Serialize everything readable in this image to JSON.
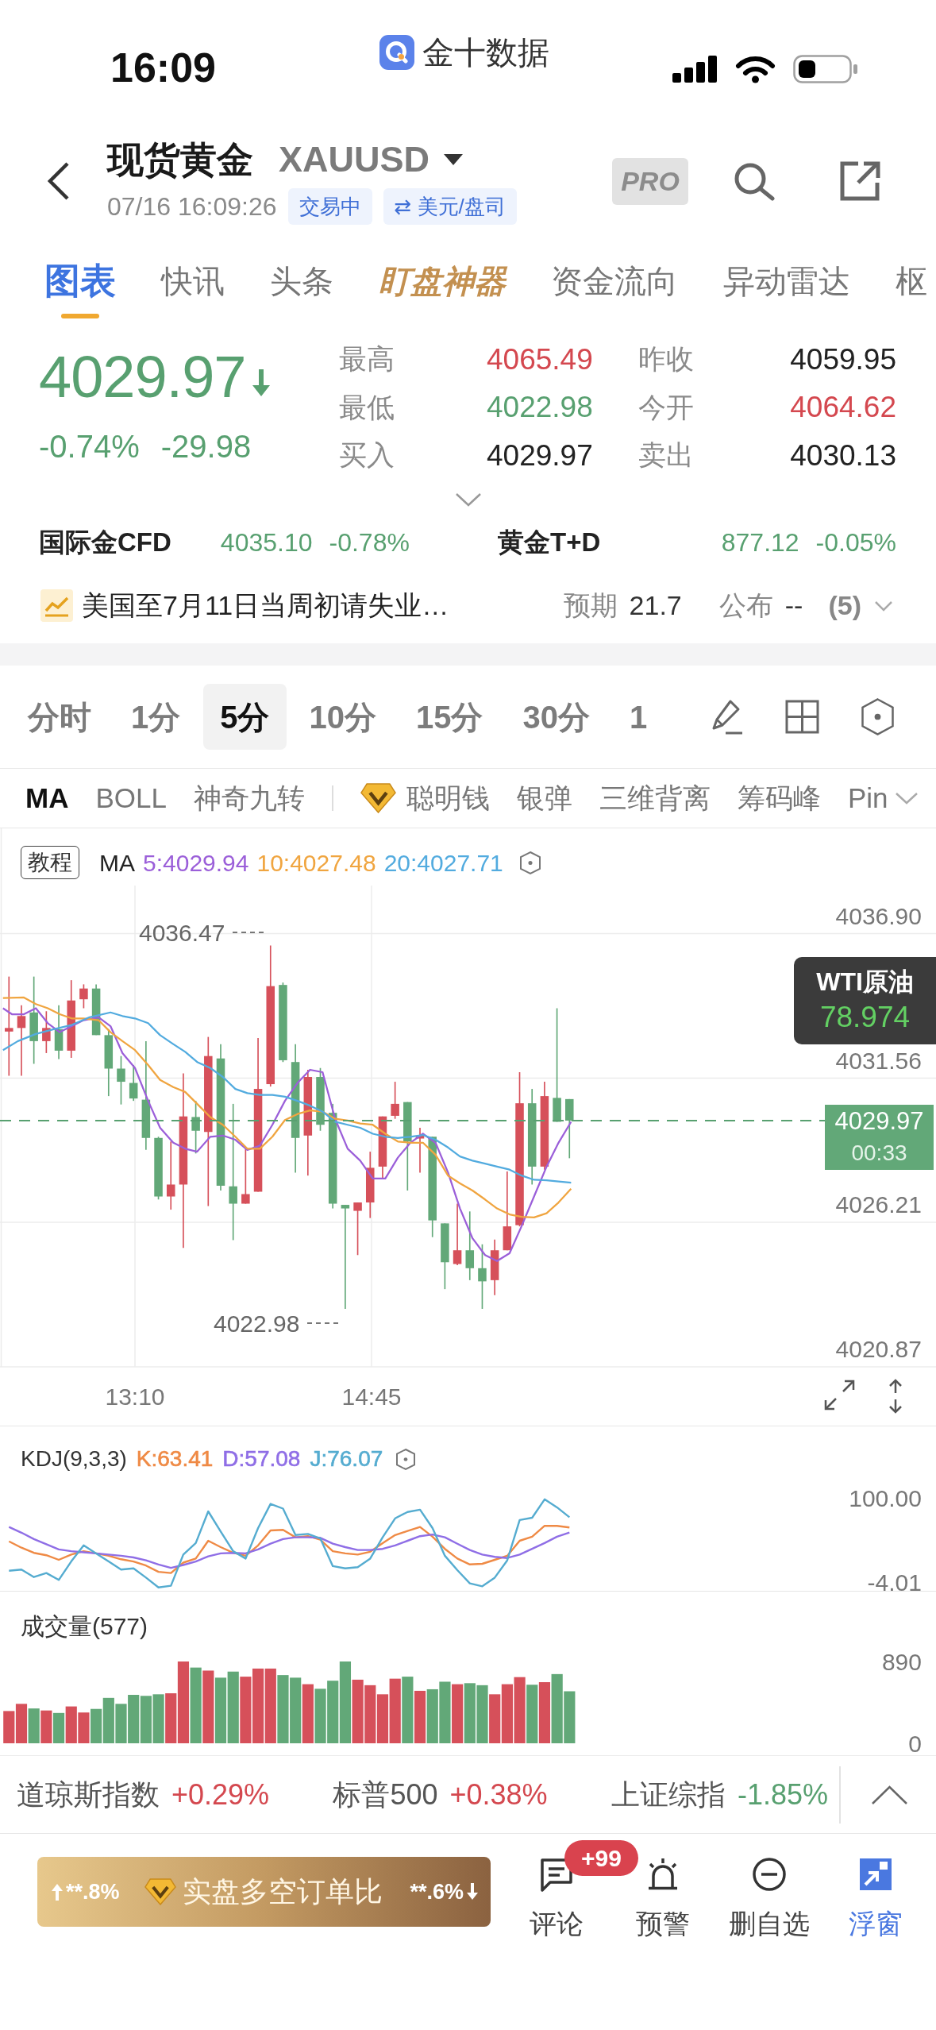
{
  "status_bar": {
    "time": "16:09",
    "app_name": "金十数据"
  },
  "header": {
    "title": "现货黄金",
    "symbol": "XAUUSD",
    "timestamp": "07/16 16:09:26",
    "badges": [
      "交易中",
      "⇄ 美元/盘司"
    ],
    "pro": "PRO"
  },
  "tabs": [
    {
      "label": "图表",
      "kind": "text",
      "selected": true
    },
    {
      "label": "快讯",
      "kind": "text",
      "selected": false
    },
    {
      "label": "头条",
      "kind": "text",
      "selected": false
    },
    {
      "label": "盯盘神器",
      "kind": "promo",
      "selected": false
    },
    {
      "label": "资金流向",
      "kind": "text",
      "selected": false
    },
    {
      "label": "异动雷达",
      "kind": "text",
      "selected": false
    },
    {
      "label": "枢",
      "kind": "text",
      "selected": false
    }
  ],
  "quote": {
    "price": "4029.97",
    "rising": false,
    "change_percent": "-0.74%",
    "change": "-29.98",
    "stats": [
      {
        "label": "最高",
        "value": "4065.49",
        "color": "#d4484f"
      },
      {
        "label": "昨收",
        "value": "4059.95",
        "color": "#222222"
      },
      {
        "label": "最低",
        "value": "4022.98",
        "color": "#58a070"
      },
      {
        "label": "今开",
        "value": "4064.62",
        "color": "#d4484f"
      },
      {
        "label": "买入",
        "value": "4029.97",
        "color": "#222222"
      },
      {
        "label": "卖出",
        "value": "4030.13",
        "color": "#222222"
      }
    ]
  },
  "related": [
    {
      "name": "国际金CFD",
      "price": "4035.10",
      "change": "-0.78%",
      "color": "#58a070"
    },
    {
      "name": "黄金T+D",
      "price": "877.12",
      "change": "-0.05%",
      "color": "#58a070"
    }
  ],
  "event": {
    "title": "美国至7月11日当周初请失业…",
    "expected_label": "预期",
    "expected": "21.7",
    "actual_label": "公布",
    "actual": "--",
    "count": "(5)"
  },
  "periods": [
    {
      "label": "分时",
      "selected": false
    },
    {
      "label": "1分",
      "selected": false
    },
    {
      "label": "5分",
      "selected": true
    },
    {
      "label": "10分",
      "selected": false
    },
    {
      "label": "15分",
      "selected": false
    },
    {
      "label": "30分",
      "selected": false
    },
    {
      "label": "1",
      "selected": false
    }
  ],
  "indicators": [
    {
      "label": "MA",
      "kind": "basic",
      "selected": true
    },
    {
      "label": "BOLL",
      "kind": "basic",
      "selected": false
    },
    {
      "label": "神奇九转",
      "kind": "basic",
      "selected": false
    },
    {
      "label": "聪明钱",
      "kind": "premium",
      "selected": false
    },
    {
      "label": "银弹",
      "kind": "basic",
      "selected": false
    },
    {
      "label": "三维背离",
      "kind": "basic",
      "selected": false
    },
    {
      "label": "筹码峰",
      "kind": "basic",
      "selected": false
    },
    {
      "label": "Pin",
      "kind": "basic",
      "selected": false
    }
  ],
  "chart": {
    "tutorial": "教程",
    "ma_label": "MA",
    "ma": [
      {
        "text": "5:4029.94",
        "color": "#9b5fd9"
      },
      {
        "text": "10:4027.48",
        "color": "#f0a540"
      },
      {
        "text": "20:4027.71",
        "color": "#52abdf"
      }
    ],
    "y_labels": [
      "4036.90",
      "4031.56",
      "4026.21",
      "4020.87"
    ],
    "high": "4036.47",
    "low": "4022.98",
    "last": {
      "price": "4029.97",
      "countdown": "00:33"
    },
    "x_labels": [
      "13:10",
      "14:45"
    ],
    "popup": {
      "name": "WTI原油",
      "price": "78.974"
    }
  },
  "kdj": {
    "title": "KDJ(9,3,3)",
    "legend": [
      {
        "text": "K:63.41",
        "color": "#ef8a45"
      },
      {
        "text": "D:57.08",
        "color": "#8f6ee6"
      },
      {
        "text": "J:76.07",
        "color": "#55acd0"
      }
    ],
    "y_labels": [
      "100.00",
      "-4.01"
    ]
  },
  "volume": {
    "title": "成交量(577)",
    "y_labels": [
      "890",
      "0"
    ]
  },
  "tickers": [
    {
      "name": "道琼斯指数",
      "change": "+0.29%",
      "color": "#d4484f"
    },
    {
      "name": "标普500",
      "change": "+0.38%",
      "color": "#d4484f"
    },
    {
      "name": "上证综指",
      "change": "-1.85%",
      "color": "#58a070"
    }
  ],
  "toolbar": {
    "sentiment": {
      "long": "**.8%",
      "label": "实盘多空订单比",
      "short": "**.6%"
    },
    "actions": [
      {
        "label": "评论",
        "kind": "comment",
        "badge": "+99",
        "active": false
      },
      {
        "label": "预警",
        "kind": "alert",
        "active": false
      },
      {
        "label": "删自选",
        "kind": "remove",
        "active": false
      },
      {
        "label": "浮窗",
        "kind": "float",
        "active": true
      }
    ]
  }
}
